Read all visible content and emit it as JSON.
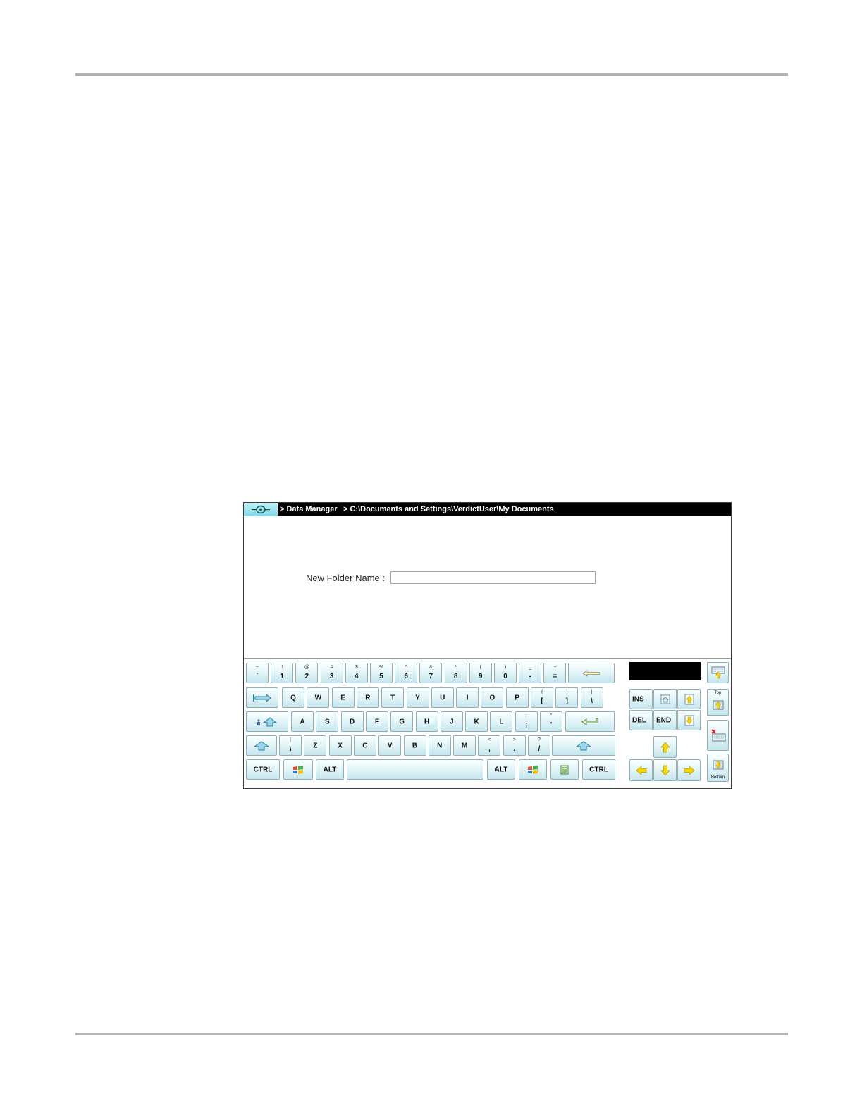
{
  "titlebar": {
    "crumb_app": "> Data Manager",
    "crumb_path": "> C:\\Documents and Settings\\VerdictUser\\My Documents"
  },
  "form": {
    "label": "New Folder Name :",
    "input_value": ""
  },
  "keyboard": {
    "rows": [
      [
        {
          "name": "key-tilde",
          "shift": "~",
          "main": "`"
        },
        {
          "name": "key-1",
          "shift": "!",
          "main": "1"
        },
        {
          "name": "key-2",
          "shift": "@",
          "main": "2"
        },
        {
          "name": "key-3",
          "shift": "#",
          "main": "3"
        },
        {
          "name": "key-4",
          "shift": "$",
          "main": "4"
        },
        {
          "name": "key-5",
          "shift": "%",
          "main": "5"
        },
        {
          "name": "key-6",
          "shift": "^",
          "main": "6"
        },
        {
          "name": "key-7",
          "shift": "&",
          "main": "7"
        },
        {
          "name": "key-8",
          "shift": "*",
          "main": "8"
        },
        {
          "name": "key-9",
          "shift": "(",
          "main": "9"
        },
        {
          "name": "key-0",
          "shift": ")",
          "main": "0"
        },
        {
          "name": "key-minus",
          "shift": "_",
          "main": "-"
        },
        {
          "name": "key-equals",
          "shift": "+",
          "main": "="
        },
        {
          "name": "key-backspace",
          "icon": "backspace-icon"
        }
      ],
      [
        {
          "name": "key-tab",
          "icon": "tab-icon"
        },
        {
          "name": "key-q",
          "main": "Q"
        },
        {
          "name": "key-w",
          "main": "W"
        },
        {
          "name": "key-e",
          "main": "E"
        },
        {
          "name": "key-r",
          "main": "R"
        },
        {
          "name": "key-t",
          "main": "T"
        },
        {
          "name": "key-y",
          "main": "Y"
        },
        {
          "name": "key-u",
          "main": "U"
        },
        {
          "name": "key-i",
          "main": "I"
        },
        {
          "name": "key-o",
          "main": "O"
        },
        {
          "name": "key-p",
          "main": "P"
        },
        {
          "name": "key-lbracket",
          "shift": "{",
          "main": "["
        },
        {
          "name": "key-rbracket",
          "shift": "}",
          "main": "]"
        },
        {
          "name": "key-backslash",
          "shift": "|",
          "main": "\\"
        }
      ],
      [
        {
          "name": "key-capslock",
          "icon": "caps-lock-icon"
        },
        {
          "name": "key-a",
          "main": "A"
        },
        {
          "name": "key-s",
          "main": "S"
        },
        {
          "name": "key-d",
          "main": "D"
        },
        {
          "name": "key-f",
          "main": "F"
        },
        {
          "name": "key-g",
          "main": "G"
        },
        {
          "name": "key-h",
          "main": "H"
        },
        {
          "name": "key-j",
          "main": "J"
        },
        {
          "name": "key-k",
          "main": "K"
        },
        {
          "name": "key-l",
          "main": "L"
        },
        {
          "name": "key-semicolon",
          "shift": ":",
          "main": ";"
        },
        {
          "name": "key-quote",
          "shift": "\"",
          "main": "'"
        },
        {
          "name": "key-enter",
          "icon": "enter-icon"
        }
      ],
      [
        {
          "name": "key-shift-left",
          "icon": "shift-icon"
        },
        {
          "name": "key-intl-backslash",
          "shift": "|",
          "main": "\\"
        },
        {
          "name": "key-z",
          "main": "Z"
        },
        {
          "name": "key-x",
          "main": "X"
        },
        {
          "name": "key-c",
          "main": "C"
        },
        {
          "name": "key-v",
          "main": "V"
        },
        {
          "name": "key-b",
          "main": "B"
        },
        {
          "name": "key-n",
          "main": "N"
        },
        {
          "name": "key-m",
          "main": "M"
        },
        {
          "name": "key-comma",
          "shift": "<",
          "main": ","
        },
        {
          "name": "key-period",
          "shift": ">",
          "main": "."
        },
        {
          "name": "key-slash",
          "shift": "?",
          "main": "/"
        },
        {
          "name": "key-shift-right",
          "icon": "shift-icon"
        }
      ],
      [
        {
          "name": "key-ctrl-left",
          "main": "CTRL"
        },
        {
          "name": "key-win-left",
          "icon": "windows-logo-icon"
        },
        {
          "name": "key-alt-left",
          "main": "ALT"
        },
        {
          "name": "key-space",
          "main": ""
        },
        {
          "name": "key-alt-right",
          "main": "ALT"
        },
        {
          "name": "key-win-right",
          "icon": "windows-logo-icon"
        },
        {
          "name": "key-menu",
          "icon": "context-menu-icon"
        },
        {
          "name": "key-ctrl-right",
          "main": "CTRL"
        }
      ]
    ],
    "nav": {
      "ins": "INS",
      "del": "DEL",
      "end": "END",
      "home_icon": "home-icon",
      "pgup_icon": "page-up-icon",
      "pgdn_icon": "page-down-icon",
      "arrow_up_icon": "arrow-up-icon",
      "arrow_left_icon": "arrow-left-icon",
      "arrow_down_icon": "arrow-down-icon",
      "arrow_right_icon": "arrow-right-icon"
    },
    "side": {
      "top_label": "Top",
      "bottom_label": "Bottom",
      "move_icon": "keyboard-move-icon",
      "close_icon": "keyboard-close-icon"
    }
  },
  "colors": {
    "titlebar_bg": "#000000",
    "key_gradient_top": "#fbffff",
    "key_gradient_bottom": "#c4e5ec",
    "arrow_yellow": "#f2d600",
    "logo_bg": "#7fd8e3"
  }
}
